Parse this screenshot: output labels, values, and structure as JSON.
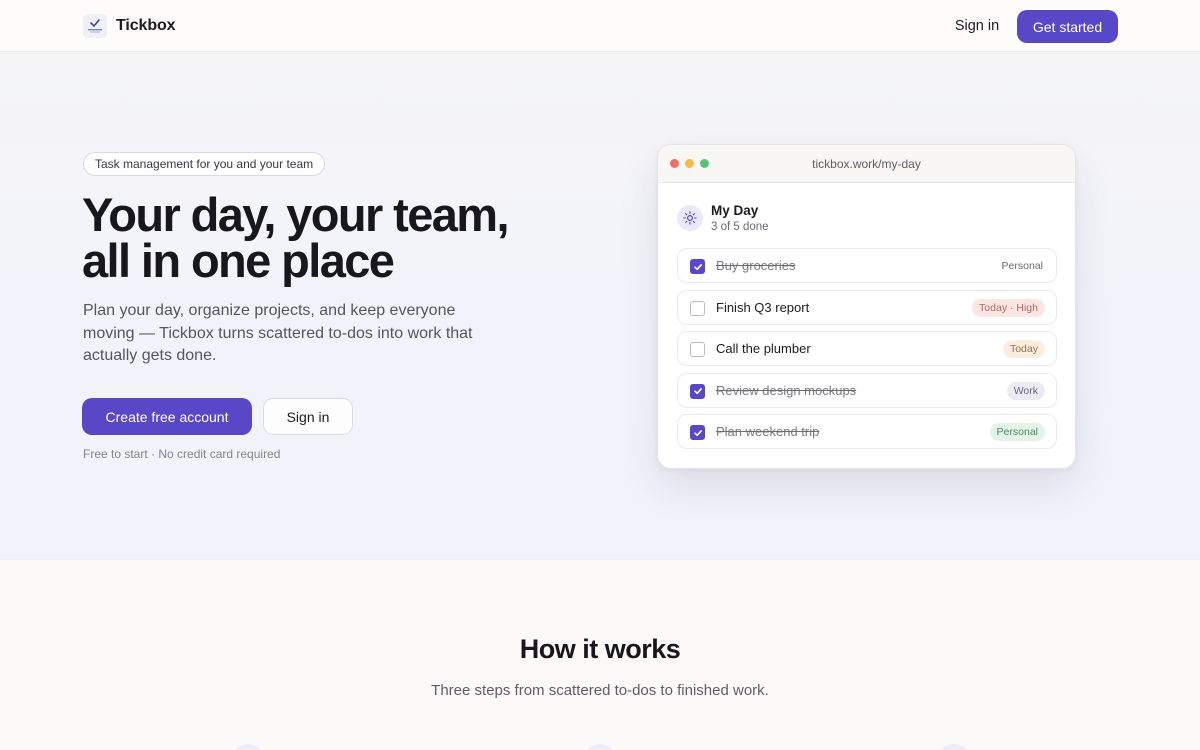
{
  "nav": {
    "brand_name": "Tickbox",
    "signin_label": "Sign in",
    "cta_label": "Get started"
  },
  "hero": {
    "pill_text": "Task management for you and your team",
    "headline_line1": "Your day, your team,",
    "headline_line2": "all in one place",
    "subcopy": "Plan your day, organize projects, and keep everyone moving — Tickbox turns scattered to-dos into work that actually gets done.",
    "primary_button": "Create free account",
    "secondary_button": "Sign in",
    "fineprint": "Free to start · No credit card required"
  },
  "mockup": {
    "url": "tickbox.work/my-day",
    "list_title": "My Day",
    "progress_text": "3 of 5 done",
    "tasks": [
      {
        "label": "Buy groceries",
        "done": true,
        "tag": "Personal",
        "tag_bg": "#ffffff",
        "tag_color": "#6b6a73"
      },
      {
        "label": "Finish Q3 report",
        "done": false,
        "tag": "Today · High",
        "tag_bg": "#fbe6e4",
        "tag_color": "#b06a60"
      },
      {
        "label": "Call the plumber",
        "done": false,
        "tag": "Today",
        "tag_bg": "#fbeee0",
        "tag_color": "#9c7448"
      },
      {
        "label": "Review design mockups",
        "done": true,
        "tag": "Work",
        "tag_bg": "#eceaf3",
        "tag_color": "#6a6677"
      },
      {
        "label": "Plan weekend trip",
        "done": true,
        "tag": "Personal",
        "tag_bg": "#e4f3e8",
        "tag_color": "#4e8a5f"
      }
    ]
  },
  "how": {
    "title": "How it works",
    "subtitle": "Three steps from scattered to-dos to finished work."
  },
  "colors": {
    "accent": "#5847c7",
    "page_bg": "#fbfaf8",
    "hero_bg": "#f2f3fa"
  },
  "icons": {
    "logo": "tickbox-logo-icon",
    "sun": "sun-icon",
    "check": "checkmark-icon"
  }
}
